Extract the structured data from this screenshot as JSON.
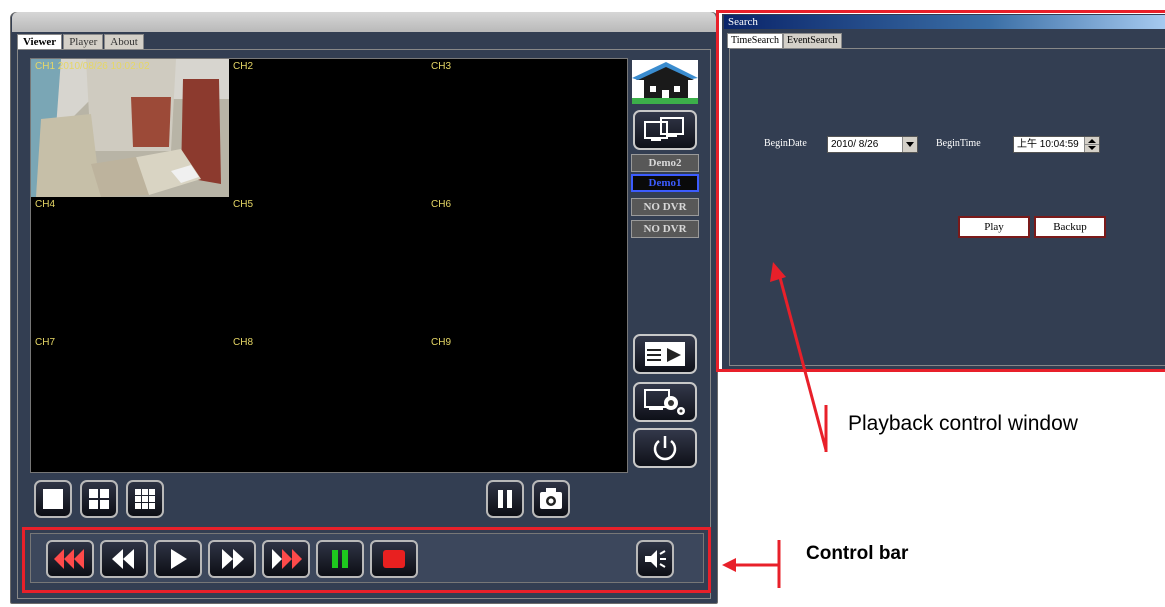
{
  "app": {
    "tabs": [
      "Viewer",
      "Player",
      "About"
    ],
    "active_tab": "Viewer"
  },
  "channels": [
    {
      "label": "CH1 2010/08/26 10:02:02"
    },
    {
      "label": "CH2"
    },
    {
      "label": "CH3"
    },
    {
      "label": "CH4"
    },
    {
      "label": "CH5"
    },
    {
      "label": "CH6"
    },
    {
      "label": "CH7"
    },
    {
      "label": "CH8"
    },
    {
      "label": "CH9"
    }
  ],
  "dvr_list": [
    {
      "label": "Demo2",
      "selected": false
    },
    {
      "label": "Demo1",
      "selected": true
    },
    {
      "label": "NO DVR",
      "selected": false
    },
    {
      "label": "NO DVR",
      "selected": false
    }
  ],
  "side_buttons": [
    "home-logo-icon",
    "remote-monitor-icon",
    "playback-icon",
    "setup-gear-icon",
    "power-icon"
  ],
  "layout_buttons": [
    "single-view-icon",
    "quad-view-icon",
    "nine-view-icon"
  ],
  "view_tools": [
    "pause-icon",
    "snapshot-camera-icon"
  ],
  "control_bar": {
    "buttons": [
      "fast-rewind-icon",
      "rewind-icon",
      "play-icon",
      "fast-forward-icon",
      "fastest-forward-icon",
      "pause-icon",
      "stop-icon"
    ],
    "audio": "speaker-icon"
  },
  "search_window": {
    "title": "Search",
    "tabs": [
      "TimeSearch",
      "EventSearch"
    ],
    "active_tab": "TimeSearch",
    "begin_date_label": "BeginDate",
    "begin_date_value": "2010/ 8/26",
    "begin_time_label": "BeginTime",
    "begin_time_value": "上午 10:04:59",
    "play_label": "Play",
    "backup_label": "Backup"
  },
  "annotations": {
    "playback_window": "Playback control window",
    "control_bar": "Control bar"
  },
  "colors": {
    "highlight": "#e8202a",
    "panel": "#333e52",
    "channel_label": "#e6d766",
    "selected_dvr": "#3c5cff",
    "pause_green": "#1ec81e"
  }
}
